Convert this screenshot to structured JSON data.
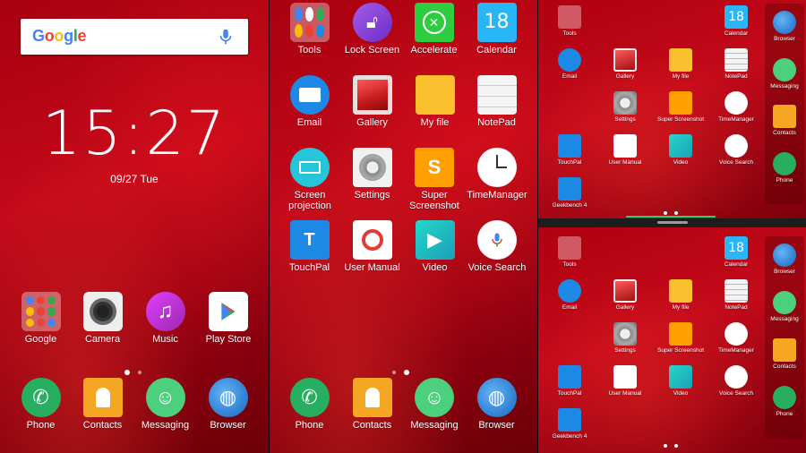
{
  "panel1": {
    "search": {
      "logo_letters": [
        "G",
        "o",
        "o",
        "g",
        "l",
        "e"
      ],
      "logo_colors": [
        "#4285F4",
        "#EA4335",
        "#FBBC05",
        "#4285F4",
        "#34A853",
        "#EA4335"
      ]
    },
    "clock": {
      "time": "15:27",
      "date": "09/27 Tue"
    },
    "apps": [
      "Google",
      "Camera",
      "Music",
      "Play Store"
    ],
    "dock": [
      "Phone",
      "Contacts",
      "Messaging",
      "Browser"
    ]
  },
  "panel2": {
    "apps": [
      "Tools",
      "Lock Screen",
      "Accelerate",
      "Calendar",
      "Email",
      "Gallery",
      "My file",
      "NotePad",
      "Screen projection",
      "Settings",
      "Super Screenshot",
      "TimeManager",
      "TouchPal",
      "User Manual",
      "Video",
      "Voice Search"
    ],
    "calendar_day": "18",
    "dock": [
      "Phone",
      "Contacts",
      "Messaging",
      "Browser"
    ]
  },
  "panel3": {
    "apps": [
      "Tools",
      "Calendar",
      "Email",
      "Gallery",
      "My file",
      "NotePad",
      "Settings",
      "Super Screenshot",
      "TimeManager",
      "TouchPal",
      "User Manual",
      "Video",
      "Voice Search",
      "Geekbench 4"
    ],
    "calendar_day": "18",
    "dock": [
      "Browser",
      "Messaging",
      "Contacts",
      "Phone"
    ]
  },
  "colors": {
    "wallpaper": "#b4000f",
    "accent_green": "#2ecc71"
  }
}
